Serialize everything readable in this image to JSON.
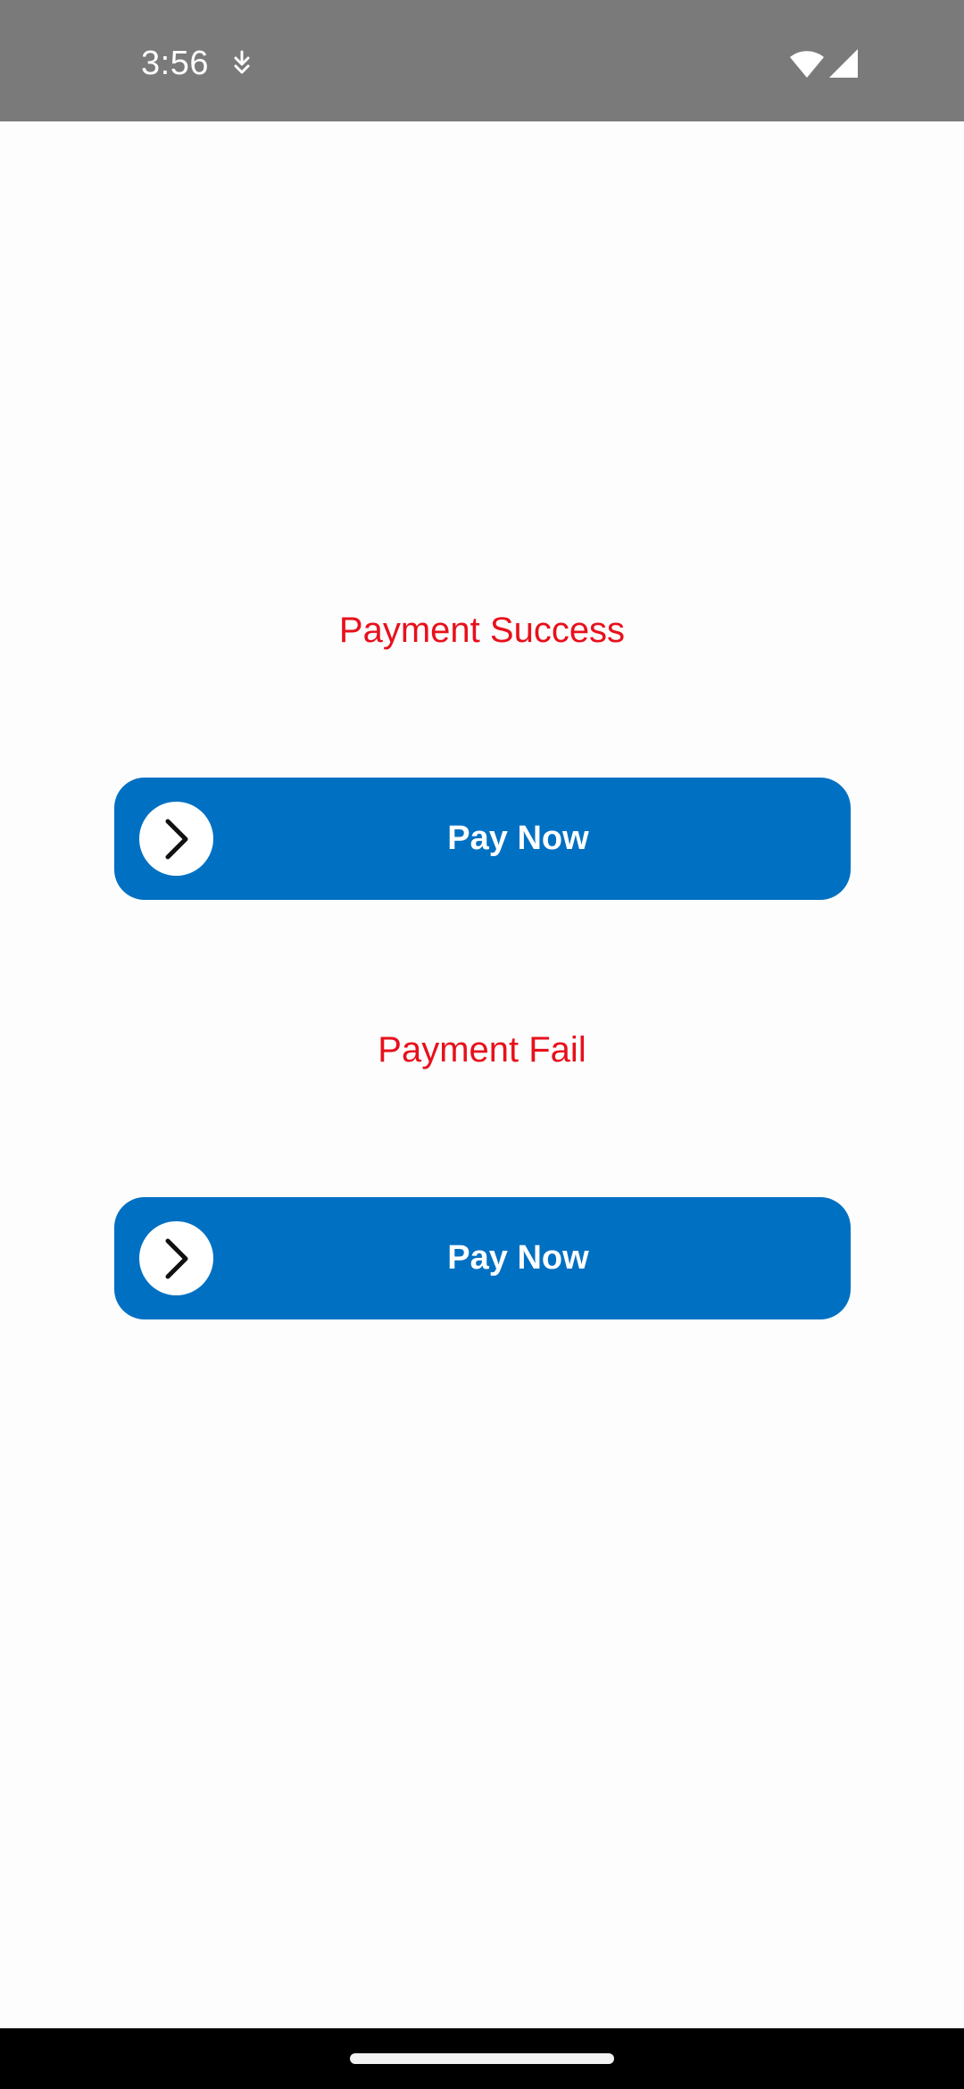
{
  "status_bar": {
    "time": "3:56",
    "icons": [
      "download-icon",
      "wifi-icon",
      "cellular-signal-icon"
    ]
  },
  "main": {
    "sections": [
      {
        "status_label": "Payment Success",
        "button_label": "Pay Now",
        "button_icon": "chevron-right-icon"
      },
      {
        "status_label": "Payment Fail",
        "button_label": "Pay Now",
        "button_icon": "chevron-right-icon"
      }
    ]
  },
  "colors": {
    "label_red": "#e8101c",
    "button_blue": "#0070c3",
    "status_bar_gray": "#7a7a7a",
    "background": "#fdfdfd"
  }
}
